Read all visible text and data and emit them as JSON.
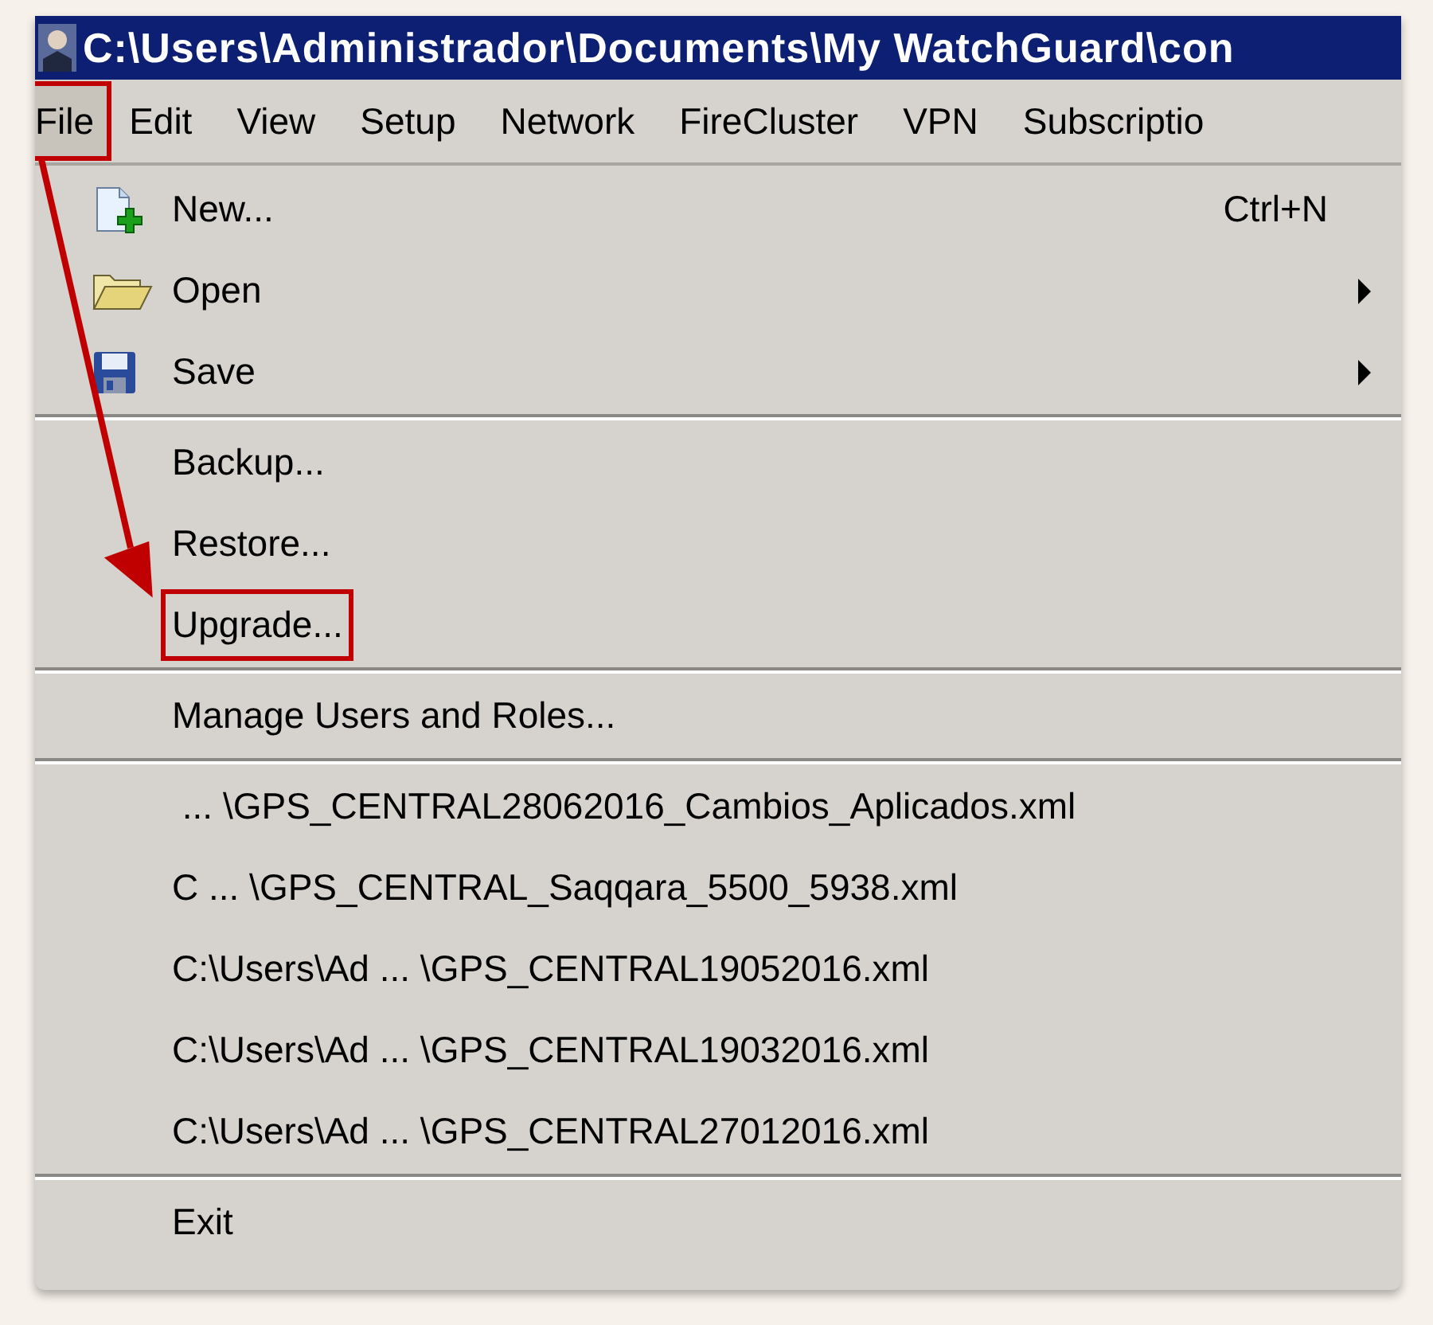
{
  "window": {
    "title": "C:\\Users\\Administrador\\Documents\\My WatchGuard\\con"
  },
  "menu_bar": [
    {
      "label": "File",
      "selected": true,
      "highlighted": true
    },
    {
      "label": "Edit",
      "selected": false,
      "highlighted": false
    },
    {
      "label": "View",
      "selected": false,
      "highlighted": false
    },
    {
      "label": "Setup",
      "selected": false,
      "highlighted": false
    },
    {
      "label": "Network",
      "selected": false,
      "highlighted": false
    },
    {
      "label": "FireCluster",
      "selected": false,
      "highlighted": false
    },
    {
      "label": "VPN",
      "selected": false,
      "highlighted": false
    },
    {
      "label": "Subscriptio",
      "selected": false,
      "highlighted": false
    }
  ],
  "menu": {
    "sections": [
      [
        {
          "label": "New...",
          "shortcut": "Ctrl+N",
          "submenu": false,
          "highlighted": false
        },
        {
          "label": "Open",
          "submenu": true,
          "highlighted": false
        },
        {
          "label": "Save",
          "submenu": true,
          "highlighted": false
        }
      ],
      [
        {
          "label": "Backup...",
          "submenu": false,
          "highlighted": false
        },
        {
          "label": "Restore...",
          "submenu": false,
          "highlighted": false
        },
        {
          "label": "Upgrade...",
          "submenu": false,
          "highlighted": true
        }
      ],
      [
        {
          "label": "Manage Users and Roles...",
          "submenu": false,
          "highlighted": false
        }
      ],
      [
        {
          "label": " ... \\GPS_CENTRAL28062016_Cambios_Aplicados.xml",
          "submenu": false,
          "highlighted": false
        },
        {
          "label": "C ... \\GPS_CENTRAL_Saqqara_5500_5938.xml",
          "submenu": false,
          "highlighted": false
        },
        {
          "label": "C:\\Users\\Ad ... \\GPS_CENTRAL19052016.xml",
          "submenu": false,
          "highlighted": false
        },
        {
          "label": "C:\\Users\\Ad ... \\GPS_CENTRAL19032016.xml",
          "submenu": false,
          "highlighted": false
        },
        {
          "label": "C:\\Users\\Ad ... \\GPS_CENTRAL27012016.xml",
          "submenu": false,
          "highlighted": false
        }
      ],
      [
        {
          "label": "Exit",
          "submenu": false,
          "highlighted": false
        }
      ]
    ]
  }
}
